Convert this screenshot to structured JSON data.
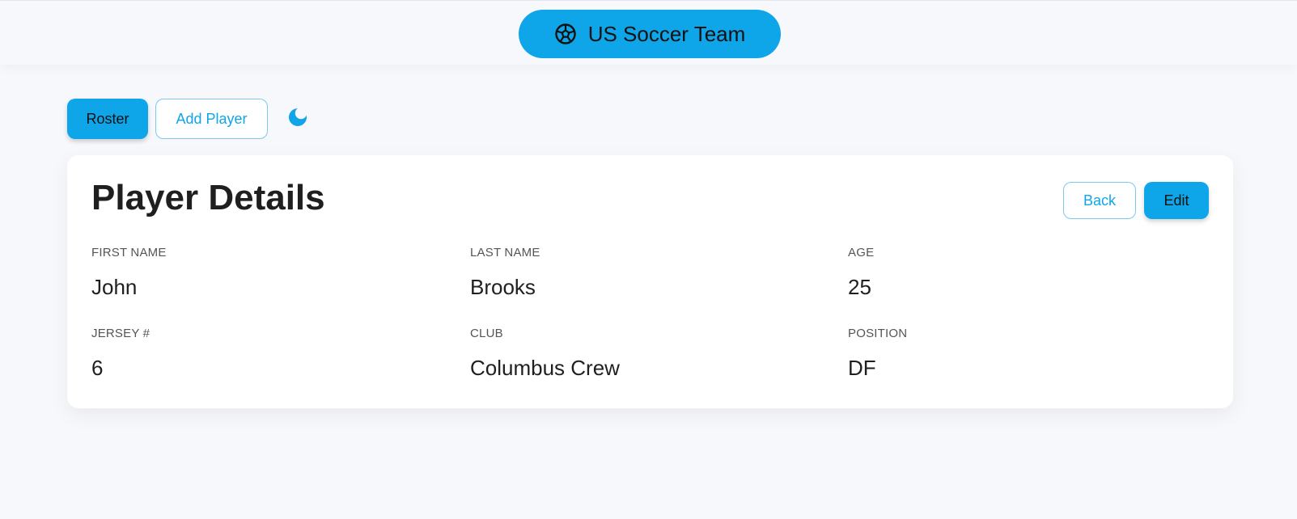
{
  "header": {
    "brand_label": "US Soccer Team",
    "brand_icon": "soccer-ball-icon"
  },
  "nav": {
    "roster_label": "Roster",
    "add_player_label": "Add Player",
    "theme_icon": "moon-icon"
  },
  "card": {
    "title": "Player Details",
    "back_label": "Back",
    "edit_label": "Edit",
    "fields": [
      {
        "label": "FIRST NAME",
        "value": "John"
      },
      {
        "label": "LAST NAME",
        "value": "Brooks"
      },
      {
        "label": "AGE",
        "value": "25"
      },
      {
        "label": "JERSEY #",
        "value": "6"
      },
      {
        "label": "CLUB",
        "value": "Columbus Crew"
      },
      {
        "label": "POSITION",
        "value": "DF"
      }
    ]
  },
  "colors": {
    "accent": "#0ea5e9",
    "background": "#f7f8fb",
    "card": "#ffffff"
  }
}
